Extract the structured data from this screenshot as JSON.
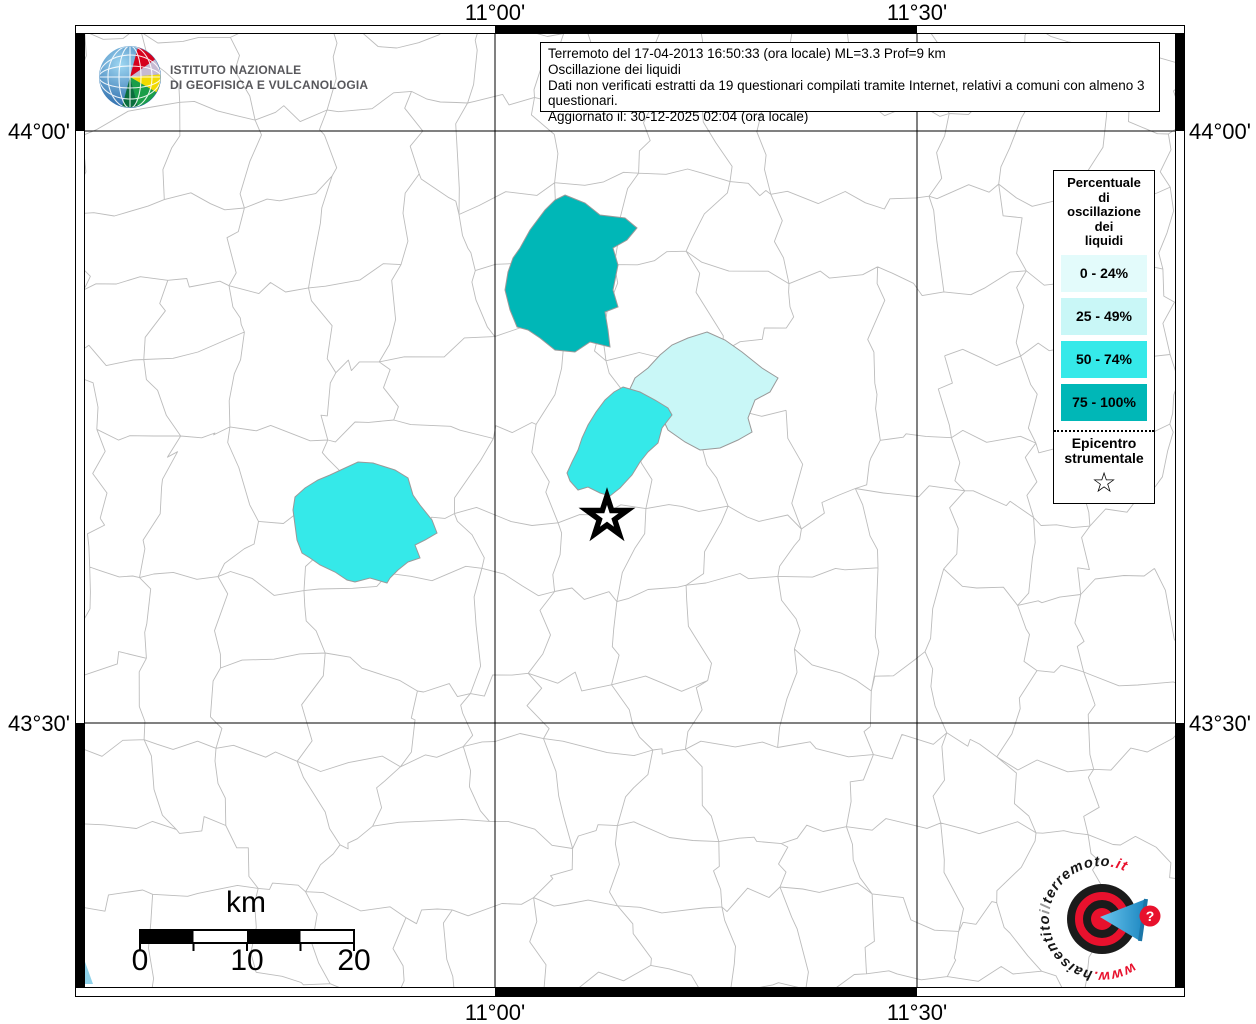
{
  "ingv": {
    "line1": "ISTITUTO NAZIONALE",
    "line2": "DI GEOFISICA E VULCANOLOGIA"
  },
  "info_box": {
    "lines": [
      "Terremoto del 17-04-2013 16:50:33 (ora locale) ML=3.3 Prof=9 km",
      "Oscillazione dei liquidi",
      "Dati non verificati estratti da 19 questionari compilati tramite Internet, relativi a comuni con almeno 3 questionari.",
      "Aggiornato il: 30-12-2025 02:04 (ora locale)"
    ]
  },
  "legend": {
    "title_lines": [
      "Percentuale",
      "di",
      "oscillazione",
      "dei",
      "liquidi"
    ],
    "classes": [
      {
        "label": "0 - 24%",
        "color": "#e3fbfb"
      },
      {
        "label": "25 - 49%",
        "color": "#c9f7f7"
      },
      {
        "label": "50 - 74%",
        "color": "#35e9e9"
      },
      {
        "label": "75 - 100%",
        "color": "#00b7b7"
      }
    ],
    "epicenter_lines": [
      "Epicentro",
      "strumentale"
    ],
    "star": "☆"
  },
  "axes": {
    "lon": [
      {
        "label": "11°00'"
      },
      {
        "label": "11°30'"
      }
    ],
    "lat": [
      {
        "label": "44°00'"
      },
      {
        "label": "43°30'"
      }
    ]
  },
  "scalebar": {
    "unit": "km",
    "ticks": [
      "0",
      "10",
      "20"
    ]
  },
  "watermark": {
    "www": "www.",
    "part1": "haisentito",
    "part2": "il",
    "part3": "terremoto",
    "tld": ".it",
    "badge": "?"
  },
  "map": {
    "border_color": "#bcbcbc",
    "grid_color": "#000000"
  }
}
